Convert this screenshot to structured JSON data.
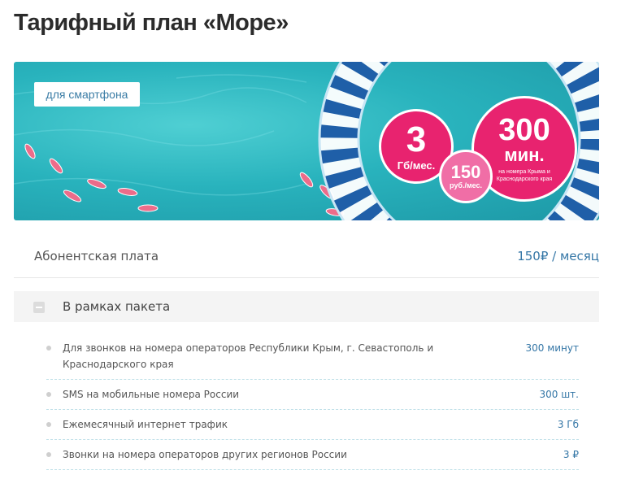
{
  "page": {
    "title": "Тарифный план «Море»"
  },
  "banner": {
    "tag": "для смартфона",
    "data_bubble": {
      "value": "3",
      "unit": "Гб/мес."
    },
    "minutes_bubble": {
      "value": "300",
      "unit": "мин.",
      "note": "на номера Крыма и Краснодарского края"
    },
    "price_bubble": {
      "value": "150",
      "unit": "руб./мес."
    },
    "colors": {
      "sea": "#29b3bd",
      "bubble": "#e8236f",
      "bubble_light": "#f06ea6",
      "ring_stripe": "#1f5fa8"
    }
  },
  "fee": {
    "label": "Абонентская плата",
    "value": "150₽ / месяц"
  },
  "package": {
    "label": "В рамках пакета",
    "icon": "minus-icon",
    "items": [
      {
        "label": "Для звонков на номера операторов Республики Крым, г. Севастополь и Краснодарского края",
        "value": "300 минут"
      },
      {
        "label": "SMS на мобильные номера России",
        "value": "300 шт."
      },
      {
        "label": "Ежемесячный интернет трафик",
        "value": "3 Гб"
      },
      {
        "label": "Звонки на номера операторов других регионов России",
        "value": "3 ₽"
      }
    ]
  },
  "colors": {
    "accent": "#3476a6",
    "text": "#444444"
  }
}
